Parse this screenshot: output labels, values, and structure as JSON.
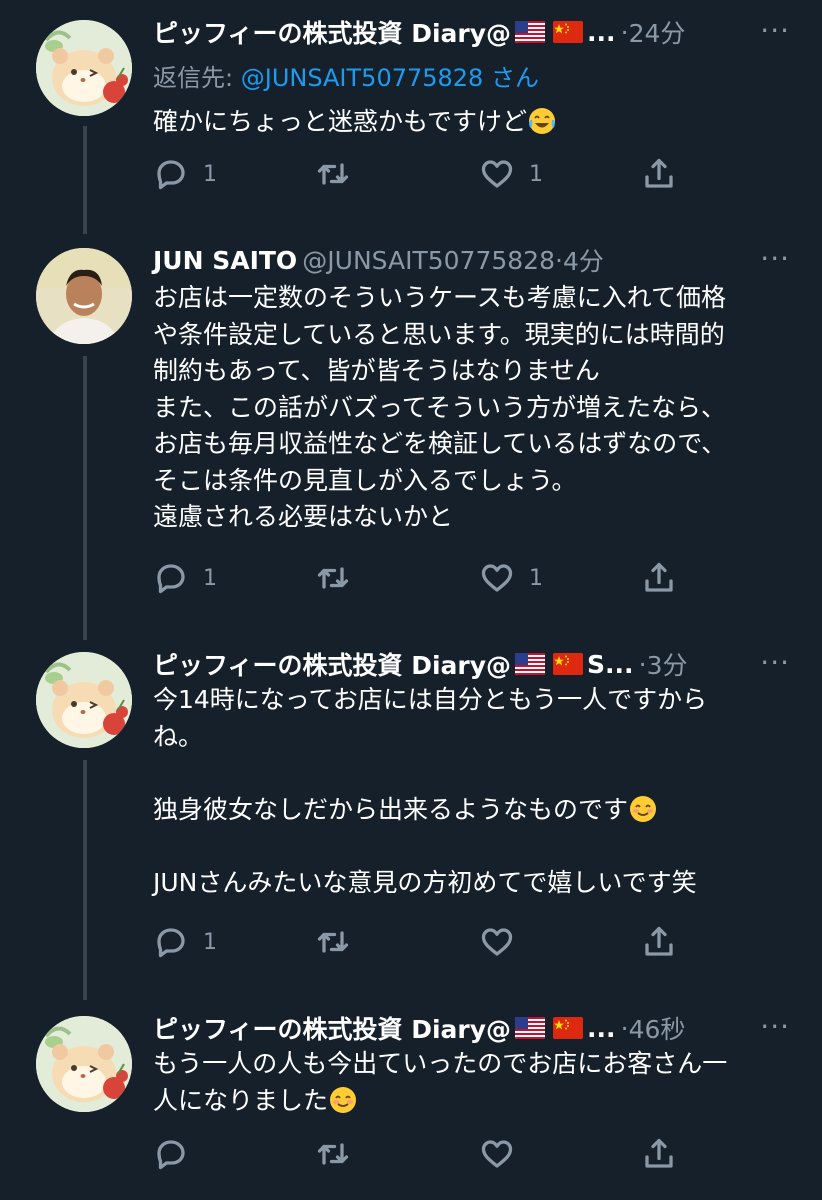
{
  "tweets": [
    {
      "name": "ピッフィーの株式投資 Diary@",
      "flags_suffix": "...",
      "time": "24分",
      "reply_prefix": "返信先:",
      "reply_mention": "@JUNSAIT50775828",
      "reply_suffix": "さん",
      "text": "確かにちょっと迷惑かもですけど",
      "emoji": "face-with-tears-of-joy-icon",
      "reply_count": "1",
      "like_count": "1"
    },
    {
      "name": "JUN SAITO",
      "handle": "@JUNSAIT50775828",
      "time": "4分",
      "text": "お店は一定数のそういうケースも考慮に入れて価格\nや条件設定していると思います。現実的には時間的\n制約もあって、皆が皆そうはなりません\nまた、この話がバズってそういう方が増えたなら、\nお店も毎月収益性などを検証しているはずなので、\nそこは条件の見直しが入るでしょう。\n遠慮される必要はないかと",
      "reply_count": "1",
      "like_count": "1"
    },
    {
      "name": "ピッフィーの株式投資 Diary@",
      "flags_suffix": "S...",
      "time": "3分",
      "text_1": "今14時になってお店には自分ともう一人ですから\nね。\n\n独身彼女なしだから出来るようなものです",
      "text_2": "\n\nJUNさんみたいな意見の方初めてで嬉しいです笑",
      "emoji": "smiling-face-icon",
      "reply_count": "1",
      "like_count": ""
    },
    {
      "name": "ピッフィーの株式投資 Diary@",
      "flags_suffix": "...",
      "time": "46秒",
      "text": "もう一人の人も今出ていったのでお店にお客さん一\n人になりました",
      "emoji": "smiling-face-icon",
      "reply_count": "",
      "like_count": ""
    }
  ],
  "separator": "·",
  "more_glyph": "···",
  "colors": {
    "background": "#15202b",
    "text": "#ffffff",
    "secondary": "#8b98a5",
    "link": "#1d9bf0",
    "thread_line": "#38444d"
  }
}
